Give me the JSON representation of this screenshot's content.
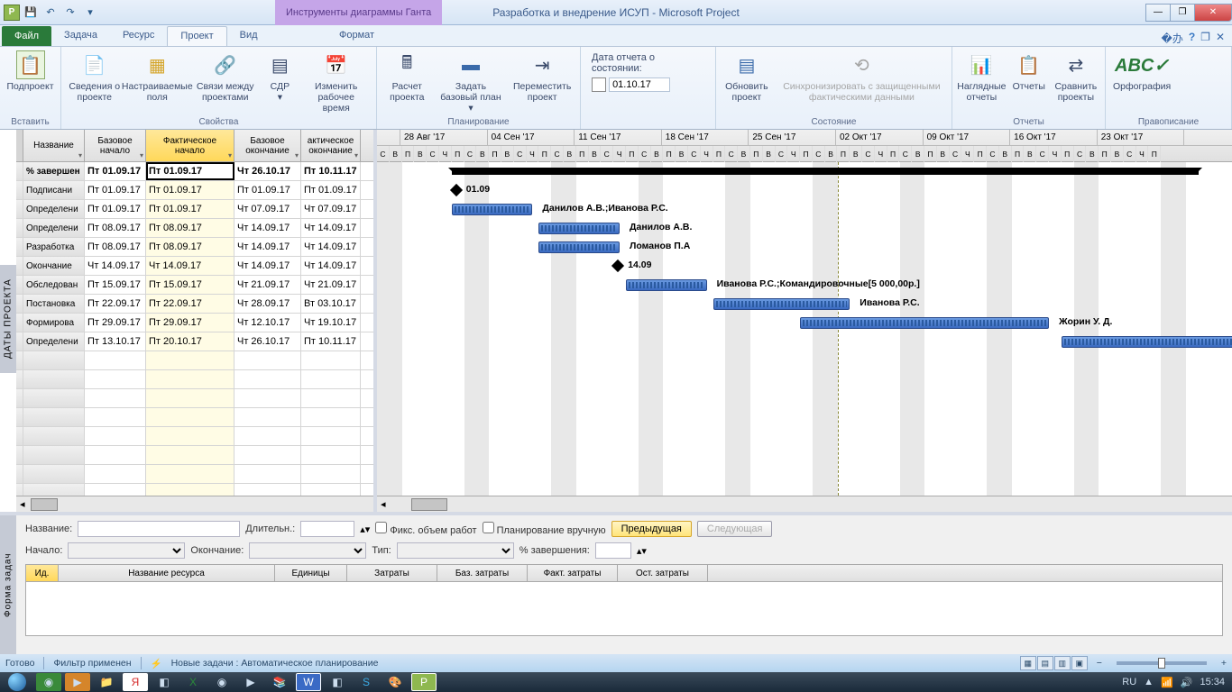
{
  "title": "Разработка и внедрение ИСУП  -  Microsoft Project",
  "contextual_tab": "Инструменты диаграммы Ганта",
  "ribbon": {
    "file": "Файл",
    "tabs": [
      "Задача",
      "Ресурс",
      "Проект",
      "Вид"
    ],
    "active": "Проект",
    "fmt": "Формат",
    "groups": {
      "insert": {
        "label": "Вставить",
        "btn": "Подпроект"
      },
      "props": {
        "label": "Свойства",
        "b1": "Сведения о проекте",
        "b2": "Настраиваемые поля",
        "b3": "Связи между проектами",
        "b4": "СДР",
        "b5": "Изменить рабочее время"
      },
      "plan": {
        "label": "Планирование",
        "b1": "Расчет проекта",
        "b2": "Задать базовый план",
        "b3": "Переместить проект"
      },
      "date_label": "Дата отчета о состоянии:",
      "date_value": "01.10.17",
      "status": {
        "label": "Состояние",
        "b1": "Обновить проект",
        "b2": "Синхронизировать с защищенными фактическими данными"
      },
      "reports": {
        "label": "Отчеты",
        "b1": "Наглядные отчеты",
        "b2": "Отчеты",
        "b3": "Сравнить проекты"
      },
      "spell": {
        "label": "Правописание",
        "b1": "Орфография"
      }
    }
  },
  "side_left": "ДАТЫ ПРОЕКТА",
  "grid": {
    "headers": [
      "Название",
      "Базовое начало",
      "Фактическое начало",
      "Базовое окончание",
      "актическое окончание"
    ],
    "rows": [
      {
        "n": "% завершен",
        "c": [
          "Пт 01.09.17",
          "Пт 01.09.17",
          "Чт 26.10.17",
          "Пт 10.11.17"
        ],
        "summary": true
      },
      {
        "n": "Подписани",
        "c": [
          "Пт 01.09.17",
          "Пт 01.09.17",
          "Пт 01.09.17",
          "Пт 01.09.17"
        ]
      },
      {
        "n": "Определени",
        "c": [
          "Пт 01.09.17",
          "Пт 01.09.17",
          "Чт 07.09.17",
          "Чт 07.09.17"
        ]
      },
      {
        "n": "Определени",
        "c": [
          "Пт 08.09.17",
          "Пт 08.09.17",
          "Чт 14.09.17",
          "Чт 14.09.17"
        ]
      },
      {
        "n": "Разработка",
        "c": [
          "Пт 08.09.17",
          "Пт 08.09.17",
          "Чт 14.09.17",
          "Чт 14.09.17"
        ]
      },
      {
        "n": "Окончание",
        "c": [
          "Чт 14.09.17",
          "Чт 14.09.17",
          "Чт 14.09.17",
          "Чт 14.09.17"
        ]
      },
      {
        "n": "Обследован",
        "c": [
          "Пт 15.09.17",
          "Пт 15.09.17",
          "Чт 21.09.17",
          "Чт 21.09.17"
        ]
      },
      {
        "n": "Постановка",
        "c": [
          "Пт 22.09.17",
          "Пт 22.09.17",
          "Чт 28.09.17",
          "Вт 03.10.17"
        ]
      },
      {
        "n": "Формирова",
        "c": [
          "Пт 29.09.17",
          "Пт 29.09.17",
          "Чт 12.10.17",
          "Чт 19.10.17"
        ]
      },
      {
        "n": "Определени",
        "c": [
          "Пт 13.10.17",
          "Пт 20.10.17",
          "Чт 26.10.17",
          "Пт 10.11.17"
        ]
      }
    ]
  },
  "timescale": {
    "weeks": [
      "28 Авг '17",
      "04 Сен '17",
      "11 Сен '17",
      "18 Сен '17",
      "25 Сен '17",
      "02 Окт '17",
      "09 Окт '17",
      "16 Окт '17",
      "23 Окт '17"
    ],
    "days": "СВПВСЧПСВПВСЧПСВПВСЧПСВПВСЧПСВПВСЧПСВПВСЧПСВПВСЧПСВПВСЧПСВПВСЧП"
  },
  "gantt": {
    "labels": {
      "m1": "01.09",
      "t1": "Данилов А.В.;Иванова Р.С.",
      "t2": "Данилов А.В.",
      "t3": "Ломанов П.А",
      "m2": "14.09",
      "t4": "Иванова Р.С.;Командировочные[5 000,00р.]",
      "t5": "Иванова Р.С.",
      "t6": "Жорин У. Д."
    }
  },
  "form": {
    "side": "Форма задач",
    "l_name": "Название:",
    "l_dur": "Длительн.:",
    "l_fix": "Фикс. объем работ",
    "l_man": "Планирование вручную",
    "btn_prev": "Предыдущая",
    "btn_next": "Следующая",
    "l_start": "Начало:",
    "l_end": "Окончание:",
    "l_type": "Тип:",
    "l_pct": "% завершения:",
    "cols": [
      "Ид.",
      "Название ресурса",
      "Единицы",
      "Затраты",
      "Баз. затраты",
      "Факт. затраты",
      "Ост. затраты"
    ]
  },
  "status": {
    "ready": "Готово",
    "filter": "Фильтр применен",
    "newtask": "Новые задачи : Автоматическое планирование"
  },
  "tray": {
    "lang": "RU",
    "time": "15:34"
  }
}
